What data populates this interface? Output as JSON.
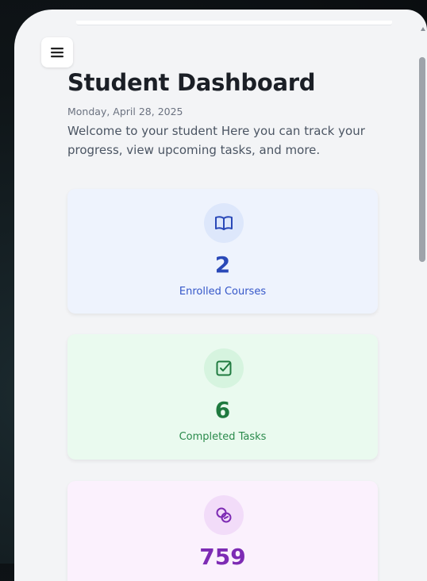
{
  "header": {
    "title": "Student Dashboard",
    "date": "Monday, April 28, 2025",
    "welcome": "Welcome to your student Here you can track your progress, view upcoming tasks, and more."
  },
  "stats": [
    {
      "icon": "book-icon",
      "value": "2",
      "label": "Enrolled Courses",
      "bg": "#eef3fd",
      "icon_bg": "#dde7fb",
      "accent": "#2a49b8"
    },
    {
      "icon": "check-square-icon",
      "value": "6",
      "label": "Completed Tasks",
      "bg": "#eafaef",
      "icon_bg": "#d6f4df",
      "accent": "#1f7a3f"
    },
    {
      "icon": "coins-icon",
      "value": "759",
      "label": "",
      "bg": "#fbf1fd",
      "icon_bg": "#f2dcf9",
      "accent": "#7d2bb4"
    }
  ]
}
